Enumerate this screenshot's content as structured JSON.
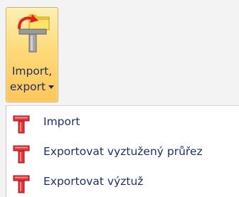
{
  "ribbon": {
    "button": {
      "label_line1": "Import,",
      "label_line2": "export"
    }
  },
  "menu": {
    "items": [
      {
        "label": "Import",
        "icon": "section-red-icon"
      },
      {
        "label": "Exportovat vyztužený průřez",
        "icon": "section-red-icon"
      },
      {
        "label": "Exportovat výztuž",
        "icon": "section-red-icon"
      }
    ]
  },
  "colors": {
    "button_gradient_top": "#fff0b4",
    "button_gradient_bottom": "#ffc65a",
    "button_border": "#e2a845",
    "text": "#1e2f5b",
    "icon_red": "#d9262e",
    "folder_yellow": "#f5d02b"
  }
}
